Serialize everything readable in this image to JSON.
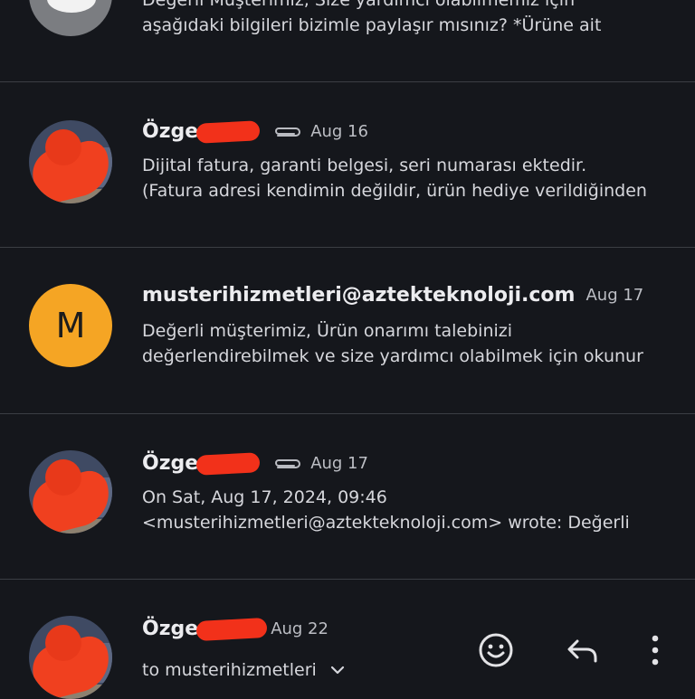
{
  "messages": [
    {
      "sender": "",
      "date": "",
      "lines": [
        "Değerli Müşterimiz, Size yardımcı olabilmemiz için",
        "aşağıdaki bilgileri bizimle paylaşır mısınız? *Ürüne ait"
      ]
    },
    {
      "sender": "Özge",
      "date": "Aug 16",
      "attachment": true,
      "lines": [
        "Dijital fatura, garanti belgesi, seri numarası ektedir.",
        "(Fatura adresi kendimin değildir, ürün hediye verildiğinden"
      ]
    },
    {
      "sender": "musterihizmetleri@aztekteknoloji.com",
      "avatar_letter": "M",
      "avatar_color": "#f5a524",
      "date": "Aug 17",
      "lines": [
        "Değerli müşterimiz, Ürün onarımı talebinizi",
        "değerlendirebilmek ve size yardımcı olabilmek için okunur"
      ]
    },
    {
      "sender": "Özge",
      "date": "Aug 17",
      "attachment": true,
      "lines": [
        "On Sat, Aug 17, 2024, 09:46",
        "<musterihizmetleri@aztekteknoloji.com> wrote: Değerli"
      ]
    },
    {
      "sender": "Özge",
      "date": "Aug 22",
      "recipient_line": "to musterihizmetleri"
    }
  ],
  "actions": {
    "emoji_icon": "emoji-smile-icon",
    "reply_icon": "reply-arrow-icon",
    "more_icon": "more-vertical-icon"
  },
  "colors": {
    "background": "#15171c",
    "divider": "#3b3e44",
    "redaction": "#f2311a",
    "avatar_m": "#f5a524"
  }
}
